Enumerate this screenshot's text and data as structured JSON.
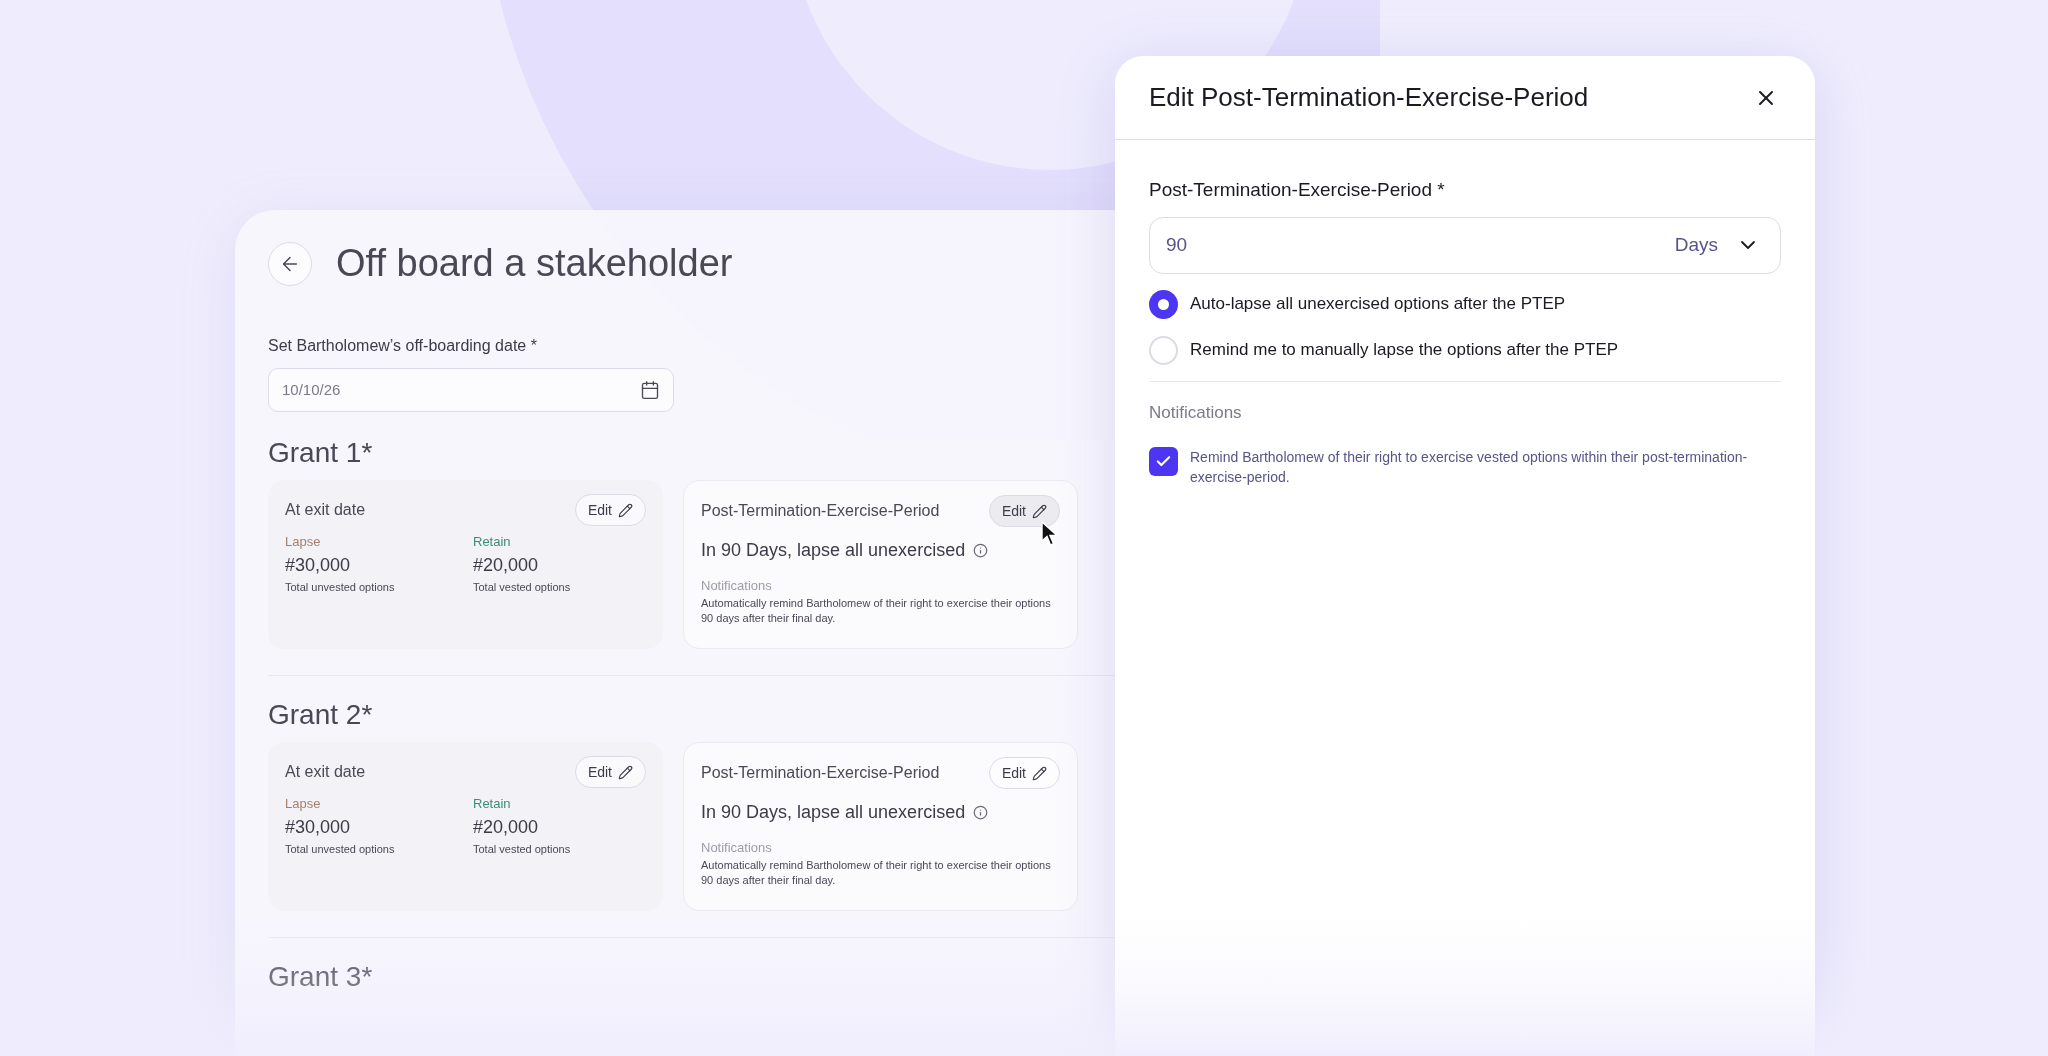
{
  "offboarding": {
    "title": "Off board a stakeholder",
    "date_label": "Set Bartholomew’s off-boarding date *",
    "date_value": "10/10/26",
    "grants": [
      {
        "title": "Grant 1*",
        "exit": {
          "title": "At exit date",
          "edit": "Edit",
          "lapse_label": "Lapse",
          "lapse_value": "#30,000",
          "lapse_caption": "Total unvested options",
          "retain_label": "Retain",
          "retain_value": "#20,000",
          "retain_caption": "Total vested options"
        },
        "ptep": {
          "title": "Post-Termination-Exercise-Period",
          "edit": "Edit",
          "hovered": true,
          "summary": "In 90 Days, lapse all unexercised",
          "notifications_label": "Notifications",
          "notifications_text": "Automatically remind Bartholomew of their right to exercise their options 90 days after their final day."
        }
      },
      {
        "title": "Grant 2*",
        "exit": {
          "title": "At exit date",
          "edit": "Edit",
          "lapse_label": "Lapse",
          "lapse_value": "#30,000",
          "lapse_caption": "Total unvested options",
          "retain_label": "Retain",
          "retain_value": "#20,000",
          "retain_caption": "Total vested options"
        },
        "ptep": {
          "title": "Post-Termination-Exercise-Period",
          "edit": "Edit",
          "hovered": false,
          "summary": "In 90 Days, lapse all unexercised",
          "notifications_label": "Notifications",
          "notifications_text": "Automatically remind Bartholomew of their right to exercise their options 90 days after their final day."
        }
      },
      {
        "title": "Grant 3*"
      }
    ]
  },
  "edit_panel": {
    "title": "Edit Post-Termination-Exercise-Period",
    "field_label": "Post-Termination-Exercise-Period *",
    "value": "90",
    "unit": "Days",
    "options": [
      {
        "label": "Auto-lapse all unexercised options after the PTEP",
        "selected": true
      },
      {
        "label": "Remind me to manually lapse the options after the PTEP",
        "selected": false
      }
    ],
    "notifications_label": "Notifications",
    "reminder": {
      "text": "Remind Bartholomew of their right to exercise vested options within their post-termination-exercise-period.",
      "checked": true
    }
  }
}
